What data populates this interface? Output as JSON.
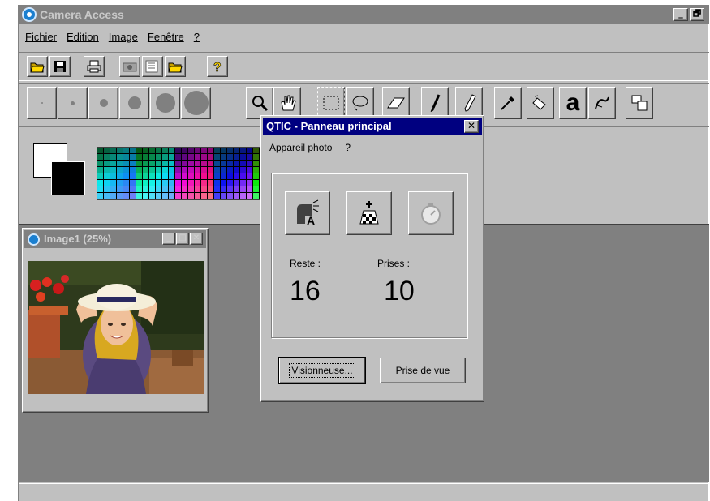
{
  "app": {
    "title": "Camera Access",
    "minimize": "_",
    "restore": "🗗"
  },
  "menubar": [
    "Fichier",
    "Edition",
    "Image",
    "Fenêtre",
    "?"
  ],
  "image_window": {
    "title": "Image1 (25%)",
    "minimize": "_",
    "maximize": "□",
    "close": "✕"
  },
  "dialog": {
    "title": "QTIC - Panneau principal",
    "close": "✕",
    "menu": [
      "Appareil photo",
      "?"
    ],
    "remaining_label": "Reste :",
    "remaining_value": "16",
    "taken_label": "Prises :",
    "taken_value": "10",
    "viewer_button": "Visionneuse...",
    "shoot_button": "Prise de vue"
  },
  "tools": {
    "text_tool": "a"
  },
  "colors": {
    "dialog_title": "#000080",
    "inactive_title": "#808080",
    "face": "#c0c0c0",
    "workspace": "#808080"
  },
  "icons": {
    "toolbar1": [
      "open-folder-icon",
      "save-icon",
      "print-icon",
      "camera-icon",
      "acquire-icon",
      "open-icon",
      "help-icon"
    ],
    "toolbar2": [
      "magnifier-icon",
      "hand-icon",
      "rect-select-icon",
      "lasso-icon",
      "eraser-icon",
      "brush-icon",
      "pencil-icon",
      "dropper-icon",
      "fill-icon",
      "text-icon",
      "smudge-icon",
      "clone-icon"
    ],
    "dialog": [
      "exposure-icon",
      "flash-icon",
      "timer-icon"
    ]
  }
}
